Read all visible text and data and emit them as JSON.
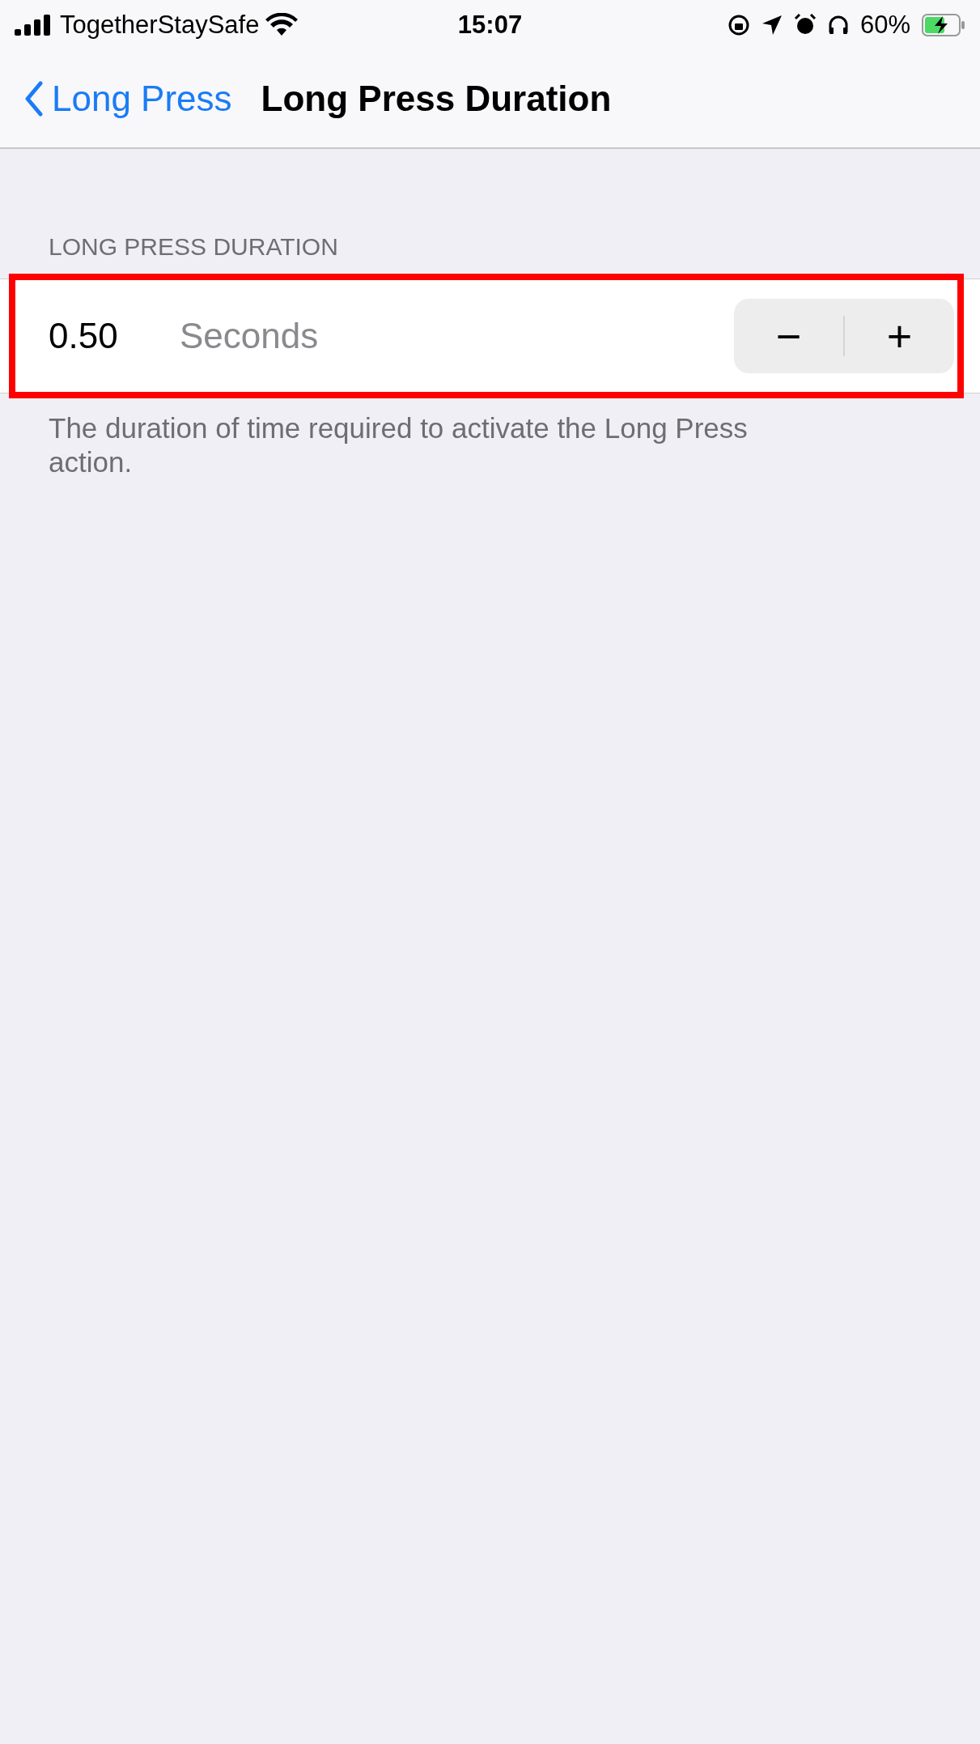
{
  "status_bar": {
    "carrier": "TogetherStaySafe",
    "time": "15:07",
    "battery": "60%",
    "charging": true
  },
  "nav": {
    "back": "Long Press",
    "title": "Long Press Duration"
  },
  "section": {
    "header": "LONG PRESS DURATION",
    "row": {
      "value": "0.50",
      "unit": "Seconds",
      "decrement": "−",
      "increment": "+",
      "highlighted": true
    },
    "footer": "The duration of time required to activate the Long Press action."
  }
}
